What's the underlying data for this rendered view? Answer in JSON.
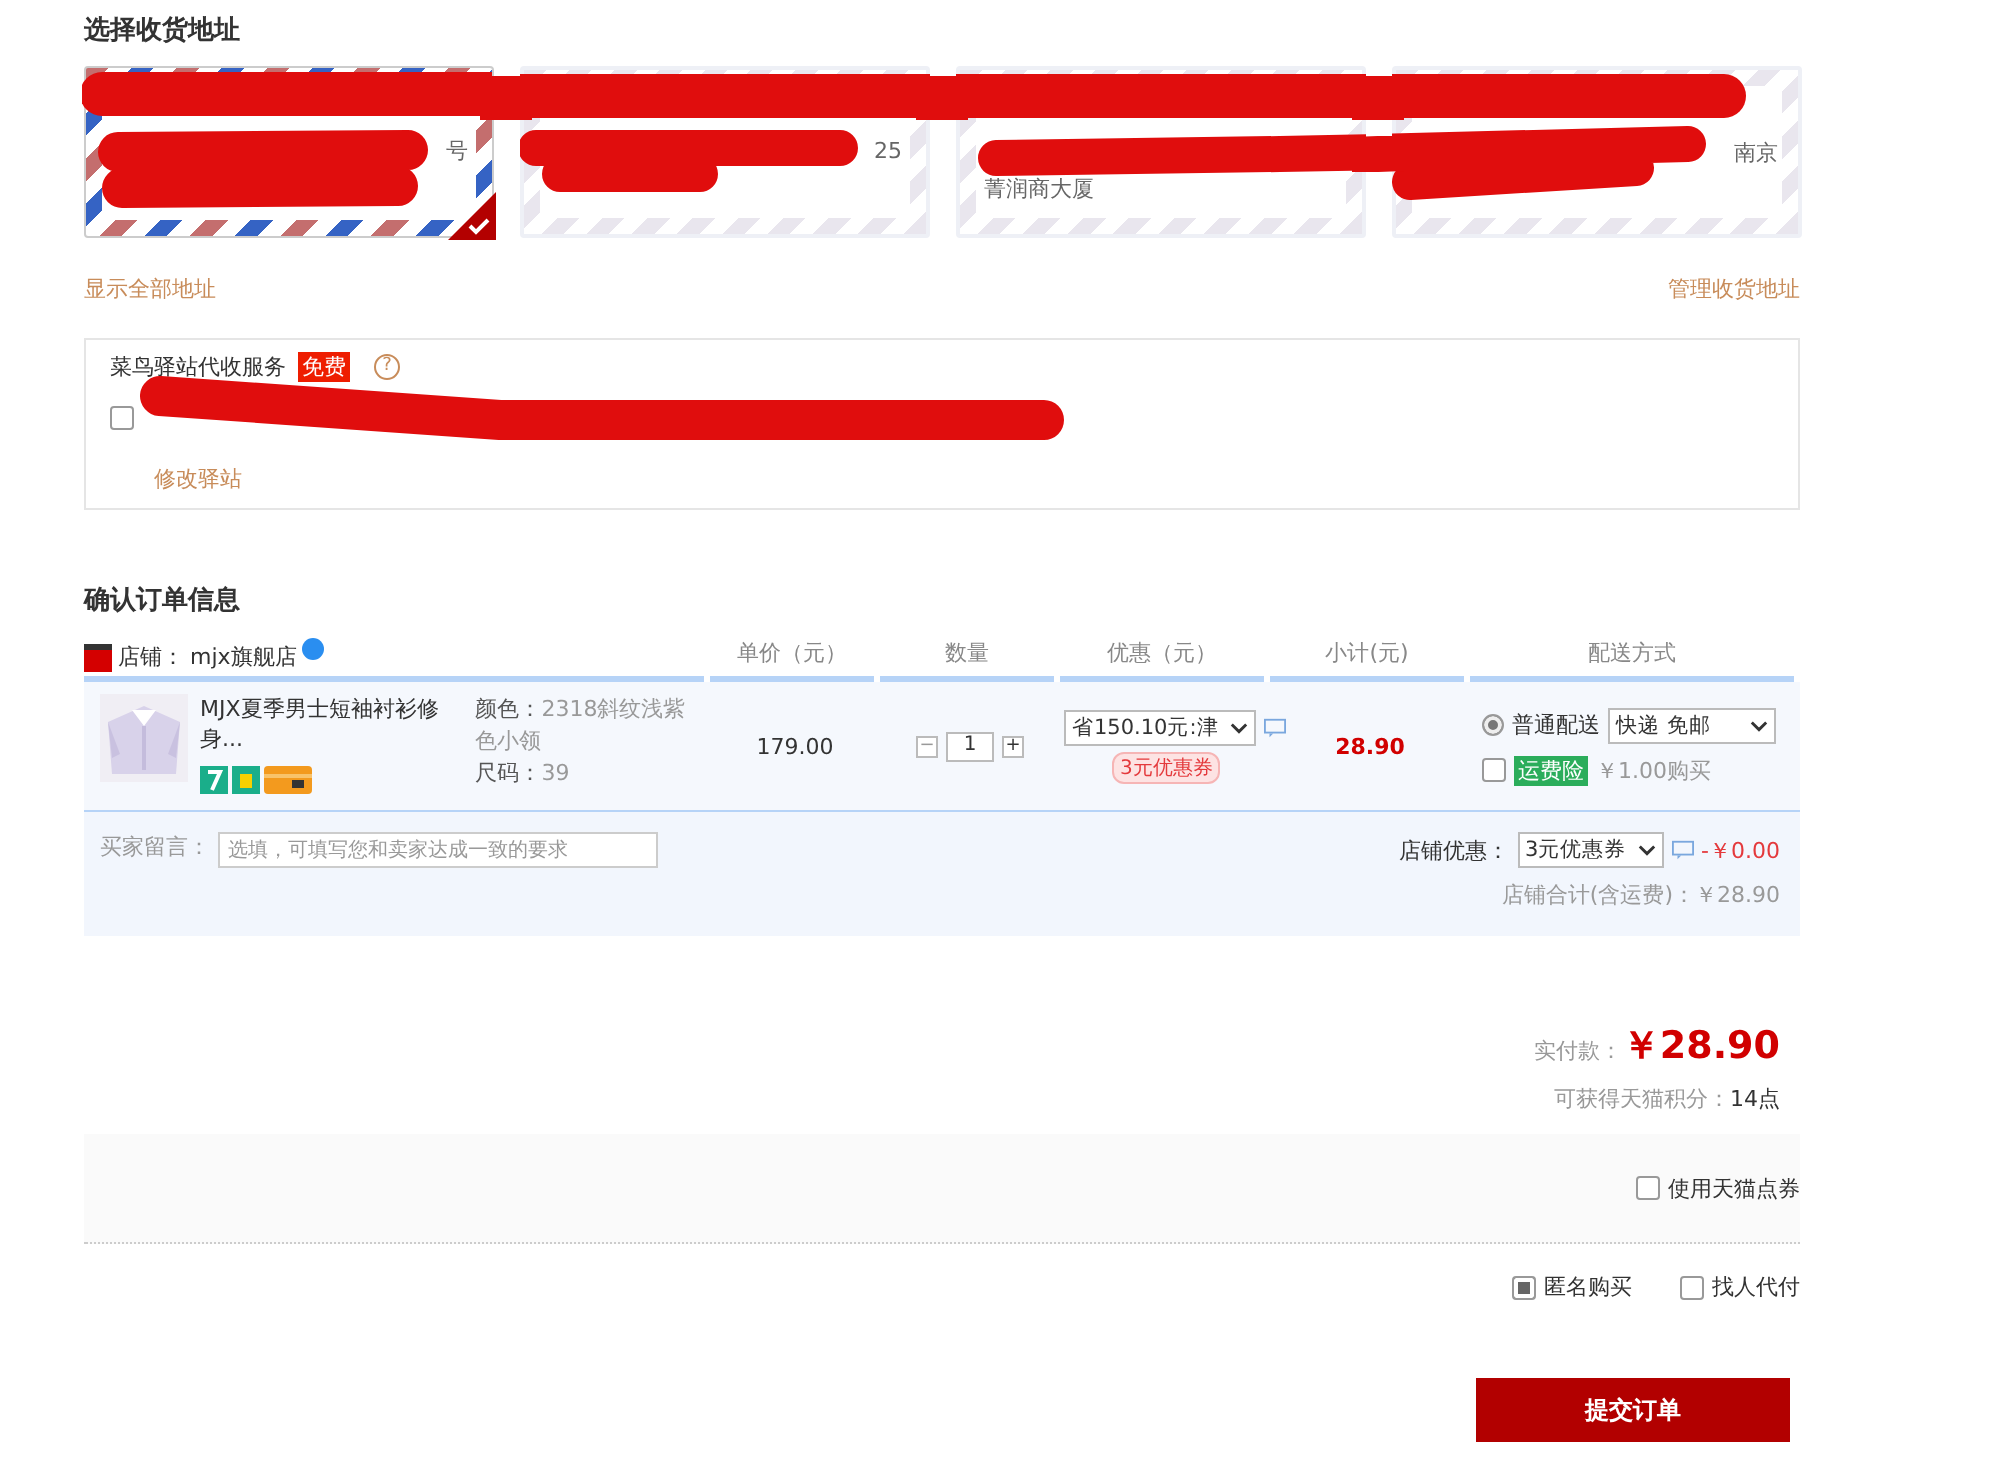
{
  "address_section": {
    "title": "选择收货地址",
    "cards": [
      {
        "visible_text": "号",
        "selected": true
      },
      {
        "visible_text": "25",
        "selected": false
      },
      {
        "visible_text": "菁润商大厦",
        "selected": false
      },
      {
        "visible_text": "南京",
        "selected": false
      }
    ],
    "show_all_link": "显示全部地址",
    "manage_link": "管理收货地址"
  },
  "station": {
    "title": "菜鸟驿站代收服务",
    "badge": "免费",
    "help": "?",
    "checked": false,
    "edit_link": "修改驿站"
  },
  "order": {
    "title": "确认订单信息",
    "shop": {
      "label": "店铺：",
      "name": "mjx旗舰店"
    },
    "columns": [
      "单价（元）",
      "数量",
      "优惠（元）",
      "小计(元)",
      "配送方式"
    ],
    "item": {
      "name": "MJX夏季男士短袖衬衫修身...",
      "color_label": "颜色：",
      "color_value": "2318斜纹浅紫色小领",
      "size_label": "尺码：",
      "size_value": "39",
      "price": "179.00",
      "quantity": "1",
      "minus": "−",
      "plus": "+",
      "discount_select": "省150.10元:津",
      "coupon_tag": "3元优惠券",
      "subtotal": "28.90",
      "delivery": {
        "option": "普通配送",
        "selected": true,
        "method": "快递 免邮"
      },
      "insurance": {
        "tag": "运费险",
        "price": "￥1.00购买",
        "checked": false
      }
    },
    "message": {
      "label": "买家留言：",
      "placeholder": "选填，可填写您和卖家达成一致的要求"
    },
    "shop_discount": {
      "label": "店铺优惠：",
      "select": "3元优惠券",
      "amount": "-￥0.00"
    },
    "shop_total": "店铺合计(含运费)：￥28.90"
  },
  "summary": {
    "pay_label": "实付款：",
    "pay_amount": "￥28.90",
    "points_label": "可获得天猫积分：",
    "points_value": "14点",
    "options": [
      {
        "label": "使用天猫点券",
        "checked": false
      }
    ],
    "final_options": [
      {
        "label": "匿名购买",
        "checked": true
      },
      {
        "label": "找人代付",
        "checked": false
      }
    ],
    "submit": "提交订单"
  }
}
